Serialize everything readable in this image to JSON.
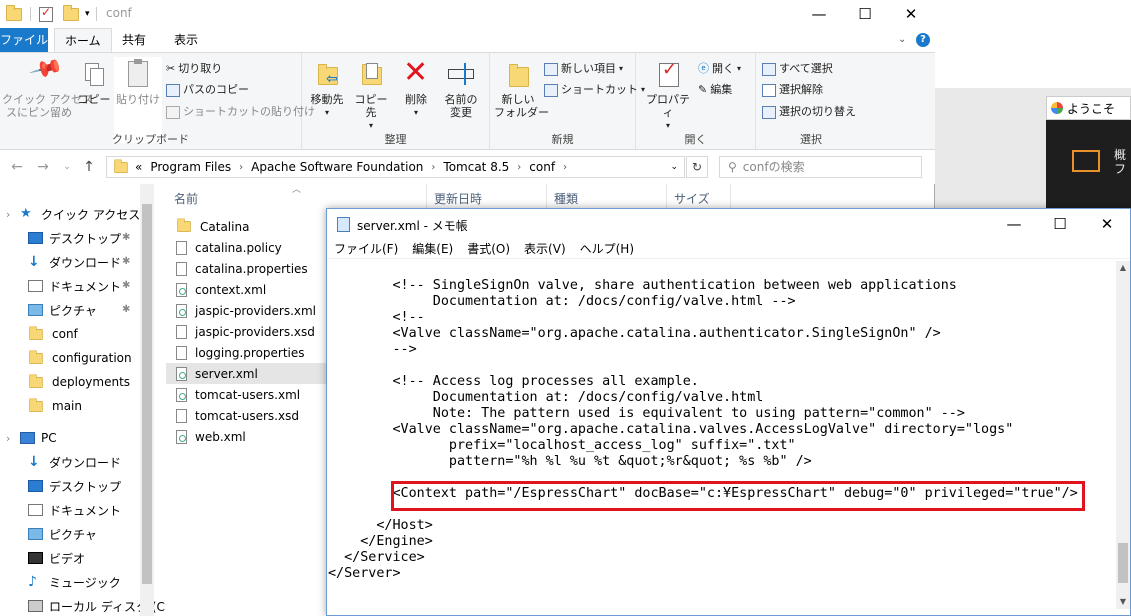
{
  "explorer": {
    "title": "conf",
    "controls": {
      "minimize": "—",
      "maximize": "☐",
      "close": "✕"
    },
    "tabs": [
      "ファイル",
      "ホーム",
      "共有",
      "表示"
    ],
    "ribbon": {
      "clipboard": {
        "label": "クリップボード",
        "pin": "クイック アクセス\nスにピン留め",
        "copy": "コピー",
        "paste": "貼り付け",
        "cut": "切り取り",
        "copy_path": "パスのコピー",
        "paste_shortcut": "ショートカットの貼り付け"
      },
      "organize": {
        "label": "整理",
        "move_to": "移動先",
        "copy_to": "コピー先",
        "delete": "削除",
        "rename": "名前の\n変更"
      },
      "new": {
        "label": "新規",
        "new_folder": "新しい\nフォルダー",
        "new_item": "新しい項目",
        "shortcut": "ショートカット"
      },
      "open": {
        "label": "開く",
        "properties": "プロパティ",
        "open": "開く",
        "edit": "編集"
      },
      "select": {
        "label": "選択",
        "select_all": "すべて選択",
        "select_none": "選択解除",
        "invert": "選択の切り替え"
      }
    },
    "breadcrumb": [
      "Program Files",
      "Apache Software Foundation",
      "Tomcat 8.5",
      "conf"
    ],
    "breadcrumb_prefix": "«",
    "search_placeholder": "confの検索",
    "nav": [
      {
        "label": "クイック アクセス",
        "icon": "star-icon"
      },
      {
        "label": "デスクトップ",
        "icon": "desktop-icon",
        "pinned": true
      },
      {
        "label": "ダウンロード",
        "icon": "download-icon",
        "pinned": true
      },
      {
        "label": "ドキュメント",
        "icon": "document-icon",
        "pinned": true
      },
      {
        "label": "ピクチャ",
        "icon": "picture-icon",
        "pinned": true
      },
      {
        "label": "conf",
        "icon": "folder-icon"
      },
      {
        "label": "configuration",
        "icon": "folder-icon"
      },
      {
        "label": "deployments",
        "icon": "folder-icon"
      },
      {
        "label": "main",
        "icon": "folder-icon"
      },
      {
        "label": "PC",
        "icon": "pc-icon"
      },
      {
        "label": "ダウンロード",
        "icon": "download-icon"
      },
      {
        "label": "デスクトップ",
        "icon": "desktop-icon"
      },
      {
        "label": "ドキュメント",
        "icon": "document-icon"
      },
      {
        "label": "ピクチャ",
        "icon": "picture-icon"
      },
      {
        "label": "ビデオ",
        "icon": "video-icon"
      },
      {
        "label": "ミュージック",
        "icon": "music-icon"
      },
      {
        "label": "ローカル ディスク (C",
        "icon": "disk-icon"
      }
    ],
    "columns": [
      "名前",
      "更新日時",
      "種類",
      "サイズ"
    ],
    "files": [
      {
        "name": "Catalina",
        "type": "folder"
      },
      {
        "name": "catalina.policy",
        "type": "file"
      },
      {
        "name": "catalina.properties",
        "type": "file"
      },
      {
        "name": "context.xml",
        "type": "xml"
      },
      {
        "name": "jaspic-providers.xml",
        "type": "xml"
      },
      {
        "name": "jaspic-providers.xsd",
        "type": "file"
      },
      {
        "name": "logging.properties",
        "type": "file"
      },
      {
        "name": "server.xml",
        "type": "xml",
        "selected": true
      },
      {
        "name": "tomcat-users.xml",
        "type": "xml"
      },
      {
        "name": "tomcat-users.xsd",
        "type": "file"
      },
      {
        "name": "web.xml",
        "type": "xml"
      }
    ]
  },
  "background": {
    "welcome_tab": "ようこそ",
    "dark_text": "概\nフ"
  },
  "notepad": {
    "title": "server.xml - メモ帳",
    "controls": {
      "minimize": "—",
      "maximize": "☐",
      "close": "✕"
    },
    "menu": [
      "ファイル(F)",
      "編集(E)",
      "書式(O)",
      "表示(V)",
      "ヘルプ(H)"
    ],
    "lines": [
      "        <!-- SingleSignOn valve, share authentication between web applications",
      "             Documentation at: /docs/config/valve.html -->",
      "        <!--",
      "        <Valve className=\"org.apache.catalina.authenticator.SingleSignOn\" />",
      "        -->",
      "",
      "        <!-- Access log processes all example.",
      "             Documentation at: /docs/config/valve.html",
      "             Note: The pattern used is equivalent to using pattern=\"common\" -->",
      "        <Valve className=\"org.apache.catalina.valves.AccessLogValve\" directory=\"logs\"",
      "               prefix=\"localhost_access_log\" suffix=\".txt\"",
      "               pattern=\"%h %l %u %t &quot;%r&quot; %s %b\" />",
      "",
      "        <Context path=\"/EspressChart\" docBase=\"c:¥EspressChart\" debug=\"0\" privileged=\"true\"/>",
      "",
      "      </Host>",
      "    </Engine>",
      "  </Service>",
      "</Server>"
    ]
  }
}
